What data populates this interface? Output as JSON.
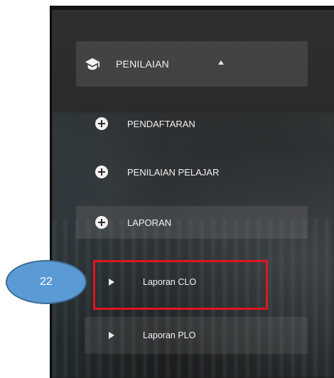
{
  "sidebar": {
    "header": {
      "label": "PENILAIAN",
      "icon": "graduation-cap-icon",
      "chevron": "chevron-up-icon"
    },
    "items": [
      {
        "label": "PENDAFTARAN",
        "icon": "plus-circle-icon"
      },
      {
        "label": "PENILAIAN PELAJAR",
        "icon": "plus-circle-icon"
      },
      {
        "label": "LAPORAN",
        "icon": "plus-circle-icon"
      }
    ],
    "subitems": [
      {
        "label": "Laporan CLO",
        "icon": "caret-right-icon"
      },
      {
        "label": "Laporan PLO",
        "icon": "caret-right-icon"
      }
    ]
  },
  "annotation": {
    "callout_number": "22",
    "highlight_color": "#e0161f",
    "callout_color": "#5b9bd5"
  }
}
